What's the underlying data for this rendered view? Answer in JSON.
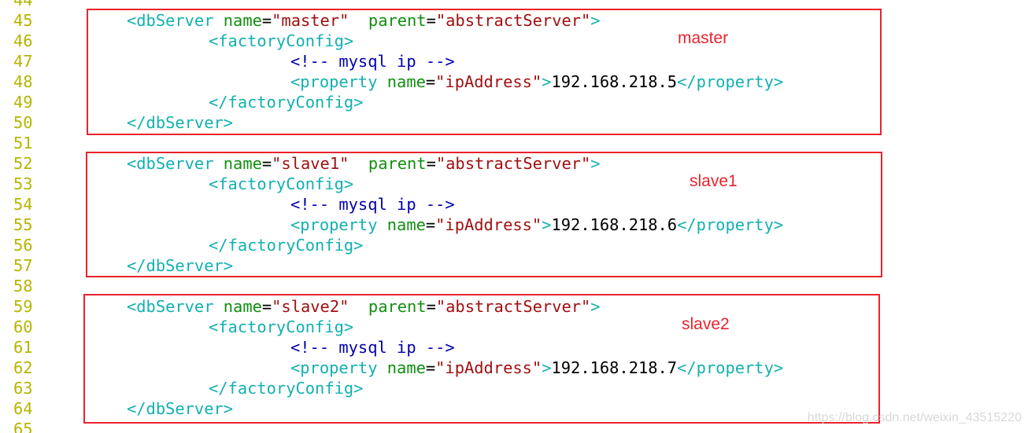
{
  "editor": {
    "lines": [
      {
        "num": "44",
        "segments": []
      },
      {
        "num": "45",
        "segments": [
          {
            "cls": "tag",
            "text": "<dbServer "
          },
          {
            "cls": "attr",
            "text": "name"
          },
          {
            "cls": "eq",
            "text": "="
          },
          {
            "cls": "str",
            "text": "\"master\""
          },
          {
            "cls": "attr",
            "text": "  parent"
          },
          {
            "cls": "eq",
            "text": "="
          },
          {
            "cls": "str",
            "text": "\"abstractServer\""
          },
          {
            "cls": "tag",
            "text": ">"
          }
        ],
        "indent": 1
      },
      {
        "num": "46",
        "segments": [
          {
            "cls": "tag",
            "text": "<factoryConfig>"
          }
        ],
        "indent": 2
      },
      {
        "num": "47",
        "segments": [
          {
            "cls": "cmt",
            "text": "<!-- mysql ip -->"
          }
        ],
        "indent": 3
      },
      {
        "num": "48",
        "segments": [
          {
            "cls": "tag",
            "text": "<property "
          },
          {
            "cls": "attr",
            "text": "name"
          },
          {
            "cls": "eq",
            "text": "="
          },
          {
            "cls": "str",
            "text": "\"ipAddress\""
          },
          {
            "cls": "tag",
            "text": ">"
          },
          {
            "cls": "txt",
            "text": "192.168.218.5"
          },
          {
            "cls": "tag",
            "text": "</property>"
          }
        ],
        "indent": 3
      },
      {
        "num": "49",
        "segments": [
          {
            "cls": "tag",
            "text": "</factoryConfig>"
          }
        ],
        "indent": 2
      },
      {
        "num": "50",
        "segments": [
          {
            "cls": "tag",
            "text": "</dbServer>"
          }
        ],
        "indent": 1
      },
      {
        "num": "51",
        "segments": []
      },
      {
        "num": "52",
        "segments": [
          {
            "cls": "tag",
            "text": "<dbServer "
          },
          {
            "cls": "attr",
            "text": "name"
          },
          {
            "cls": "eq",
            "text": "="
          },
          {
            "cls": "str",
            "text": "\"slave1\""
          },
          {
            "cls": "attr",
            "text": "  parent"
          },
          {
            "cls": "eq",
            "text": "="
          },
          {
            "cls": "str",
            "text": "\"abstractServer\""
          },
          {
            "cls": "tag",
            "text": ">"
          }
        ],
        "indent": 1
      },
      {
        "num": "53",
        "segments": [
          {
            "cls": "tag",
            "text": "<factoryConfig>"
          }
        ],
        "indent": 2
      },
      {
        "num": "54",
        "segments": [
          {
            "cls": "cmt",
            "text": "<!-- mysql ip -->"
          }
        ],
        "indent": 3
      },
      {
        "num": "55",
        "segments": [
          {
            "cls": "tag",
            "text": "<property "
          },
          {
            "cls": "attr",
            "text": "name"
          },
          {
            "cls": "eq",
            "text": "="
          },
          {
            "cls": "str",
            "text": "\"ipAddress\""
          },
          {
            "cls": "tag",
            "text": ">"
          },
          {
            "cls": "txt",
            "text": "192.168.218.6"
          },
          {
            "cls": "tag",
            "text": "</property>"
          }
        ],
        "indent": 3
      },
      {
        "num": "56",
        "segments": [
          {
            "cls": "tag",
            "text": "</factoryConfig>"
          }
        ],
        "indent": 2
      },
      {
        "num": "57",
        "segments": [
          {
            "cls": "tag",
            "text": "</dbServer>"
          }
        ],
        "indent": 1
      },
      {
        "num": "58",
        "segments": []
      },
      {
        "num": "59",
        "segments": [
          {
            "cls": "tag",
            "text": "<dbServer "
          },
          {
            "cls": "attr",
            "text": "name"
          },
          {
            "cls": "eq",
            "text": "="
          },
          {
            "cls": "str",
            "text": "\"slave2\""
          },
          {
            "cls": "attr",
            "text": "  parent"
          },
          {
            "cls": "eq",
            "text": "="
          },
          {
            "cls": "str",
            "text": "\"abstractServer\""
          },
          {
            "cls": "tag",
            "text": ">"
          }
        ],
        "indent": 1
      },
      {
        "num": "60",
        "segments": [
          {
            "cls": "tag",
            "text": "<factoryConfig>"
          }
        ],
        "indent": 2
      },
      {
        "num": "61",
        "segments": [
          {
            "cls": "cmt",
            "text": "<!-- mysql ip -->"
          }
        ],
        "indent": 3
      },
      {
        "num": "62",
        "segments": [
          {
            "cls": "tag",
            "text": "<property "
          },
          {
            "cls": "attr",
            "text": "name"
          },
          {
            "cls": "eq",
            "text": "="
          },
          {
            "cls": "str",
            "text": "\"ipAddress\""
          },
          {
            "cls": "tag",
            "text": ">"
          },
          {
            "cls": "txt",
            "text": "192.168.218.7"
          },
          {
            "cls": "tag",
            "text": "</property>"
          }
        ],
        "indent": 3
      },
      {
        "num": "63",
        "segments": [
          {
            "cls": "tag",
            "text": "</factoryConfig>"
          }
        ],
        "indent": 2
      },
      {
        "num": "64",
        "segments": [
          {
            "cls": "tag",
            "text": "</dbServer>"
          }
        ],
        "indent": 1
      },
      {
        "num": "65",
        "segments": []
      }
    ]
  },
  "annotations": {
    "master_label": "master",
    "slave1_label": "slave1",
    "slave2_label": "slave2",
    "box_color": "#e8242c"
  },
  "colors": {
    "line_number": "#b5b500",
    "tag": "#14b0b0",
    "attribute": "#109010",
    "string": "#a01010",
    "comment": "#0000b0",
    "text": "#000000"
  },
  "watermark": "https://blog.csdn.net/weixin_43515220"
}
